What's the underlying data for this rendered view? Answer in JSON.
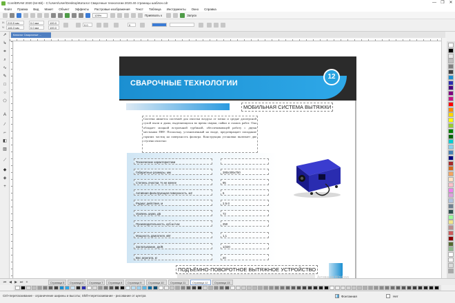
{
  "window": {
    "title": "CorelDRAW 2020 (64-Bit) - C:\\Users\\User\\Desktop\\Каталог Сварочные технологии 2020.40 страницы шаблон.cdr",
    "controls": [
      "—",
      "❐",
      "✕"
    ]
  },
  "menu": [
    "Файл",
    "Правка",
    "Вид",
    "Макет",
    "Объект",
    "Эффекты",
    "Растровые изображения",
    "Текст",
    "Таблица",
    "Инструменты",
    "Окно",
    "Справка"
  ],
  "standard_toolbar": {
    "zoom": "125%",
    "snap": "Привязать к",
    "launch": "Запуск"
  },
  "property_bar": {
    "x": "215,5 мм",
    "y": "146,3 мм",
    "w": "0,0 мм",
    "h": "0,0 мм",
    "sx": "100,0",
    "sy": "100,0",
    "angle": "0,0",
    "nodes": "0",
    "width_field": "",
    "outline": ""
  },
  "document_tab": "Каталог Сварочные ...",
  "page": {
    "number": "12",
    "header_title": "СВАРОЧНЫЕ ТЕХНОЛОГИИ",
    "section_title": "МОБИЛЬНАЯ СИСТЕМА ВЫТЯЖКИ",
    "body_text": "Система является системой для очистки воздуха от мелко и средне дисперсной сухой пыли и дыма, выделяющихся во время сварки, пайки и схожих работ. Она обладает мощной встроенной турбиной, обеспечивающей работу с двумя местными ПВУ. Поскольку, установленный на входе, предотвращает попадание горячих частиц на поверхность фильтра. Конструкция установки включает две ступени очистки:",
    "table": [
      {
        "label": "Технические характеристики",
        "value": ""
      },
      {
        "label": "Габаритные размеры, мм",
        "value": "280x305x750"
      },
      {
        "label": "Степень очистки, % не менее",
        "value": "95"
      },
      {
        "label": "Активная фильтрующая поверхность, м2",
        "value": "6"
      },
      {
        "label": "Радиус действия, м",
        "value": "2,5-3"
      },
      {
        "label": "Уровень шума, дБ",
        "value": "72"
      },
      {
        "label": "Производительность, куб.м./час",
        "value": "250"
      },
      {
        "label": "Мощность двигателя, кВт",
        "value": "1,1"
      },
      {
        "label": "Заглатывание, дн/В",
        "value": "1/220"
      },
      {
        "label": "Вес агрегата, кг",
        "value": "20"
      }
    ],
    "bottom_title": "ПОДЪЁМНО-ПОВОРОТНОЕ ВЫТЯЖНОЕ УСТРОЙСТВО"
  },
  "page_tabs": [
    "Страница 5",
    "Страница 6",
    "Страница 7",
    "Страница 8",
    "Страница 9",
    "Страница 10",
    "Страница 11",
    "Страница 12",
    "Страница 13"
  ],
  "active_page_tab": "Страница 12",
  "status": {
    "hint": "Ctrl+перетаскивание - ограничение ширины и высоты; Shift+перетаскивание - рисование от центра",
    "fill": "Фонтанная",
    "outline": "Нет"
  },
  "watermark": "Активация Windows",
  "colors": {
    "accent_blue": "#1b8fd1",
    "header_dark": "#2b2b2b",
    "active_tab": "#4f7fc1"
  }
}
